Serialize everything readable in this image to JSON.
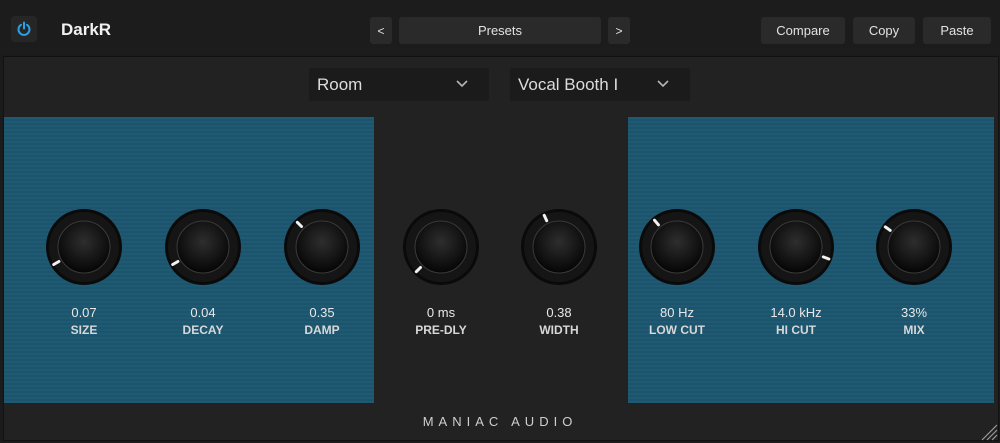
{
  "header": {
    "plugin_name": "DarkR",
    "prev_label": "<",
    "next_label": ">",
    "presets_label": "Presets",
    "compare_label": "Compare",
    "copy_label": "Copy",
    "paste_label": "Paste",
    "power_icon": "power-icon"
  },
  "dropdowns": {
    "algorithm": "Room",
    "preset": "Vocal Booth I"
  },
  "knobs": [
    {
      "id": "size",
      "value": "0.07",
      "label": "SIZE"
    },
    {
      "id": "decay",
      "value": "0.04",
      "label": "DECAY"
    },
    {
      "id": "damp",
      "value": "0.35",
      "label": "DAMP"
    },
    {
      "id": "predly",
      "value": "0 ms",
      "label": "PRE-DLY"
    },
    {
      "id": "width",
      "value": "0.38",
      "label": "WIDTH"
    },
    {
      "id": "lowcut",
      "value": "80 Hz",
      "label": "LOW CUT"
    },
    {
      "id": "hicut",
      "value": "14.0 kHz",
      "label": "HI CUT"
    },
    {
      "id": "mix",
      "value": "33%",
      "label": "MIX"
    }
  ],
  "footer": {
    "brand": "MANIAC AUDIO"
  },
  "colors": {
    "accent": "#2aa3e6",
    "panel": "#1c566f",
    "background": "#222222"
  }
}
